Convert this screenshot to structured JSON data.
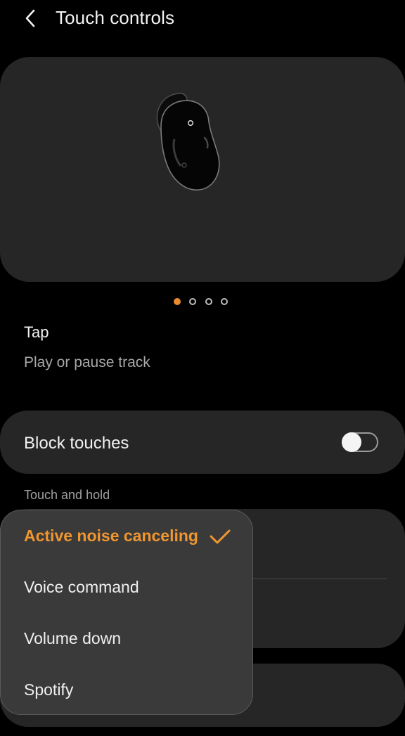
{
  "header": {
    "title": "Touch controls"
  },
  "preview": {
    "page_count": 4,
    "current_page": 1
  },
  "tap": {
    "label": "Tap",
    "value": "Play or pause track"
  },
  "block_touches": {
    "label": "Block touches",
    "enabled": false
  },
  "touch_and_hold": {
    "label": "Touch and hold"
  },
  "dropdown": {
    "options": [
      {
        "label": "Active noise canceling",
        "selected": true
      },
      {
        "label": "Voice command",
        "selected": false
      },
      {
        "label": "Volume down",
        "selected": false
      },
      {
        "label": "Spotify",
        "selected": false
      }
    ]
  },
  "colors": {
    "accent": "#f0962f",
    "card": "#262626",
    "background": "#000000"
  },
  "icons": {
    "back": "chevron-left-icon",
    "selected": "check-icon"
  }
}
